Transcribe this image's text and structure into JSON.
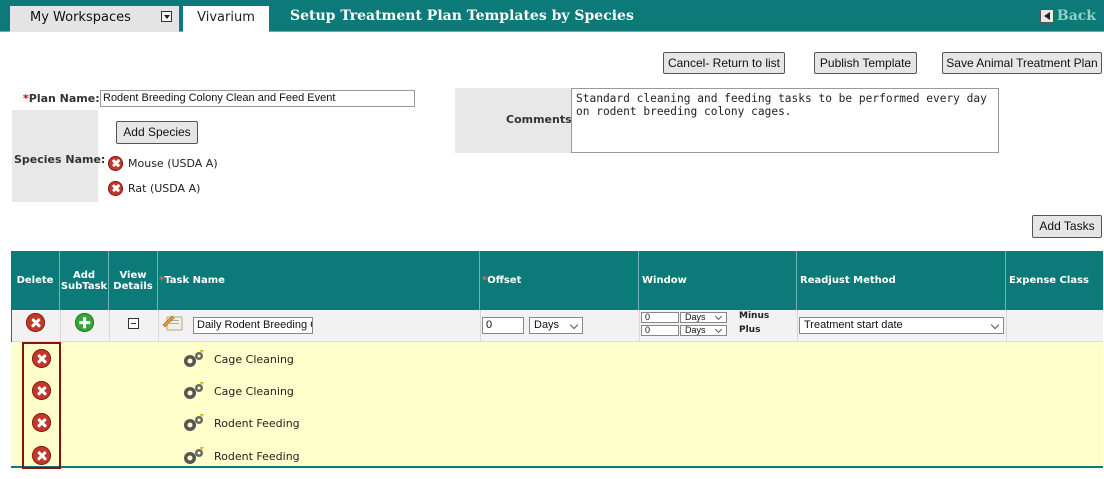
{
  "header": {
    "workspaces_label": "My Workspaces",
    "vivarium_tab": "Vivarium",
    "page_title": "Setup Treatment Plan Templates by Species",
    "back_label": "Back"
  },
  "actions": {
    "cancel": "Cancel- Return to list",
    "publish": "Publish Template",
    "save": "Save Animal Treatment Plan",
    "add_species": "Add Species",
    "add_tasks": "Add Tasks"
  },
  "form": {
    "required_mark": "*",
    "plan_name_label": "Plan Name:",
    "plan_name_value": "Rodent Breeding Colony Clean and Feed Event",
    "species_label": "Species Name:",
    "species": [
      "Mouse (USDA A)",
      "Rat (USDA A)"
    ],
    "comments_label": "Comments:",
    "comments_value": "Standard cleaning and feeding tasks to be performed every day\non rodent breeding colony cages."
  },
  "grid": {
    "headers": {
      "delete": "Delete",
      "add_subtask_1": "Add",
      "add_subtask_2": "SubTask",
      "view_details_1": "View",
      "view_details_2": "Details",
      "task_name": "Task Name",
      "offset": "Offset",
      "window": "Window",
      "readjust": "Readjust Method",
      "expense": "Expense Class"
    },
    "main_row": {
      "task_name": "Daily Rodent Breeding C",
      "offset_value": "0",
      "offset_unit": "Days",
      "window_minus_value": "0",
      "window_minus_unit": "Days",
      "window_minus_label": "Minus",
      "window_plus_value": "0",
      "window_plus_unit": "Days",
      "window_plus_label": "Plus",
      "readjust_value": "Treatment start date"
    },
    "subtasks": [
      "Cage Cleaning",
      "Cage Cleaning",
      "Rodent Feeding",
      "Rodent Feeding"
    ]
  },
  "colors": {
    "teal": "#0b7a78",
    "delete_red": "#c0392b",
    "add_green": "#3aa33a",
    "subtask_bg": "#ffffcc",
    "highlight_frame": "#8b1010"
  }
}
